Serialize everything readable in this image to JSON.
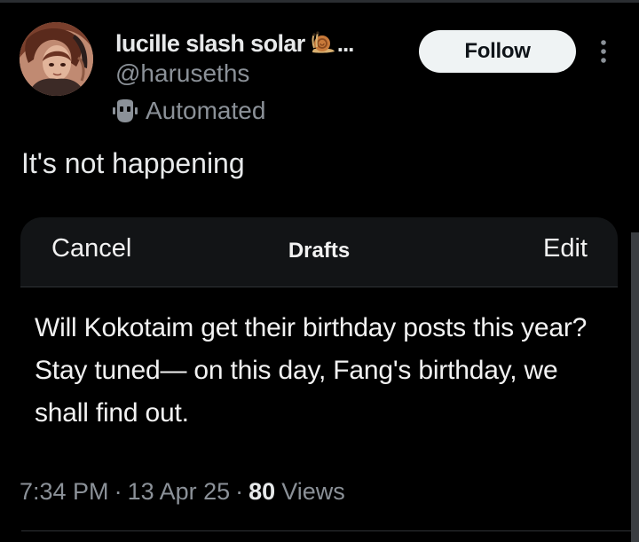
{
  "author": {
    "display_name": "lucille slash solar",
    "name_truncation": "...",
    "handle": "@haruseths",
    "automated_label": "Automated",
    "avatar_icon": "avatar-portrait",
    "name_emoji": "snail-emoji"
  },
  "actions": {
    "follow_label": "Follow",
    "more_icon": "more-vertical-icon"
  },
  "tweet": {
    "text": "It's not happening"
  },
  "drafts_card": {
    "cancel_label": "Cancel",
    "title": "Drafts",
    "edit_label": "Edit",
    "body": "Will Kokotaim get their birthday posts this year? Stay tuned— on this day, Fang's birthday, we shall find out."
  },
  "meta": {
    "time": "7:34 PM",
    "separator": "·",
    "date": "13 Apr 25",
    "views_count": "80",
    "views_label": "Views"
  },
  "colors": {
    "background": "#000000",
    "text_primary": "#e7e9ea",
    "text_secondary": "#8b9198",
    "follow_bg": "#eff3f4",
    "follow_text": "#0f1419",
    "card_header_bg": "#121416",
    "divider": "#2f3336"
  }
}
